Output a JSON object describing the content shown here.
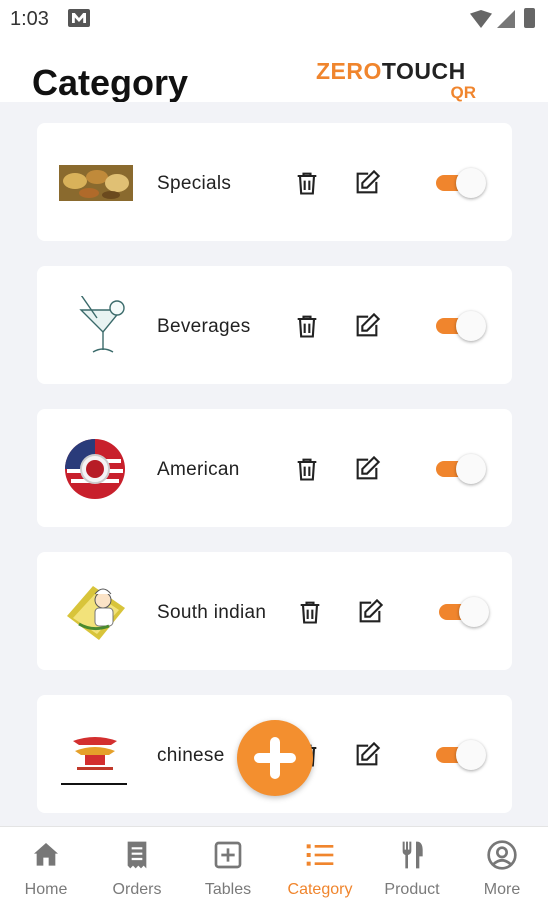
{
  "status_bar": {
    "time": "1:03",
    "icons": [
      "mail-icon",
      "wifi-icon",
      "signal-icon",
      "battery-icon"
    ]
  },
  "header": {
    "title": "Category",
    "logo_zero": "ZERO",
    "logo_touch": "TOUCH",
    "logo_qr": "QR"
  },
  "categories": [
    {
      "name": "Specials",
      "image": "food-platter-image",
      "enabled": true
    },
    {
      "name": "Beverages",
      "image": "cocktail-glass-image",
      "enabled": true
    },
    {
      "name": "American",
      "image": "us-flag-plate-image",
      "enabled": true
    },
    {
      "name": "South indian",
      "image": "chef-banana-leaf-image",
      "enabled": true
    },
    {
      "name": "chinese",
      "image": "pagoda-logo-image",
      "enabled": true
    }
  ],
  "fab": {
    "icon": "plus-icon"
  },
  "bottom_nav": [
    {
      "label": "Home",
      "icon": "home-icon",
      "active": false
    },
    {
      "label": "Orders",
      "icon": "receipt-icon",
      "active": false
    },
    {
      "label": "Tables",
      "icon": "add-square-icon",
      "active": false
    },
    {
      "label": "Category",
      "icon": "list-icon",
      "active": true
    },
    {
      "label": "Product",
      "icon": "fork-knife-icon",
      "active": false
    },
    {
      "label": "More",
      "icon": "account-circle-icon",
      "active": false
    }
  ],
  "colors": {
    "accent": "#f0852d",
    "background": "#f2f3f7",
    "card": "#ffffff",
    "nav_inactive": "#7a7a7a"
  }
}
